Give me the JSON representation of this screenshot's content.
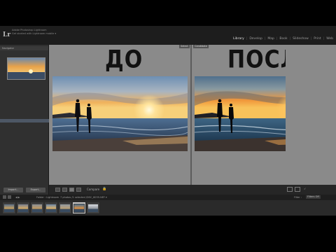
{
  "app": {
    "logo": "Lr",
    "identity_line1": "Adobe Photoshop Lightroom",
    "identity_line2": "Get started with Lightroom mobile ▾"
  },
  "modules": [
    "Library",
    "Develop",
    "Map",
    "Book",
    "Slideshow",
    "Print",
    "Web"
  ],
  "active_module": "Library",
  "left_panel": {
    "navigator_label": "Navigator",
    "tree_rows": [
      "",
      "",
      "",
      "",
      "",
      "",
      "",
      "",
      "",
      "",
      "",
      "",
      "",
      "",
      "",
      "",
      "",
      "",
      "",
      "",
      "",
      "",
      "",
      "",
      "",
      "",
      "",
      ""
    ],
    "import_button": "Import...",
    "export_button": "Export..."
  },
  "compare": {
    "select_label": "Select",
    "candidate_label": "Candidate",
    "before_text": "ДО",
    "after_text": "ПОСЛЕ"
  },
  "toolbar": {
    "compare_label": "Compare"
  },
  "filmstrip": {
    "source_label": "Folder : Lightroom",
    "count_label": "7 photos /1 selected /DSC_6035.NEF ▾",
    "filter_label": "Filter :",
    "filter_value": "Filters Off",
    "thumb_count": 7,
    "selected_index": 5
  },
  "colors": {
    "active_module": "#e0e0e0",
    "selection": "#4d5765",
    "compare_bg": "#8a8a8a"
  }
}
